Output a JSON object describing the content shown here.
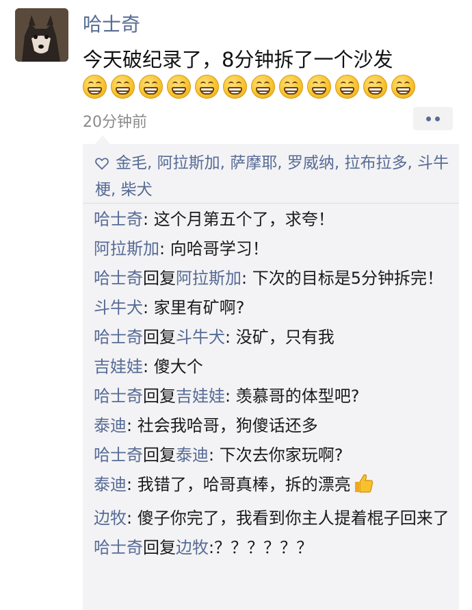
{
  "post": {
    "author": "哈士奇",
    "text": "今天破纪录了，8分钟拆了一个沙发",
    "emoji_count": 12,
    "emoji_icon": "grinning-face-icon",
    "timestamp": "20分钟前"
  },
  "likes": {
    "icon": "heart-icon",
    "names": "金毛, 阿拉斯加, 萨摩耶, 罗威纳, 拉布拉多, 斗牛梗, 柴犬"
  },
  "comments": [
    {
      "name": "哈士奇",
      "reply_word": "",
      "reply_to": "",
      "text": ": 这个月第五个了，求夸！"
    },
    {
      "name": "阿拉斯加",
      "reply_word": "",
      "reply_to": "",
      "text": ": 向哈哥学习！"
    },
    {
      "name": "哈士奇",
      "reply_word": "回复",
      "reply_to": "阿拉斯加",
      "text": ": 下次的目标是5分钟拆完！"
    },
    {
      "name": "斗牛犬",
      "reply_word": "",
      "reply_to": "",
      "text": ": 家里有矿啊?"
    },
    {
      "name": "哈士奇",
      "reply_word": "回复",
      "reply_to": "斗牛犬",
      "text": ": 没矿，只有我"
    },
    {
      "name": "吉娃娃",
      "reply_word": "",
      "reply_to": "",
      "text": ": 傻大个"
    },
    {
      "name": "哈士奇",
      "reply_word": "回复",
      "reply_to": "吉娃娃",
      "text": ": 羡慕哥的体型吧?"
    },
    {
      "name": "泰迪",
      "reply_word": "",
      "reply_to": "",
      "text": ": 社会我哈哥，狗傻话还多"
    },
    {
      "name": "哈士奇",
      "reply_word": "回复",
      "reply_to": "泰迪",
      "text": ": 下次去你家玩啊?"
    },
    {
      "name": "泰迪",
      "reply_word": "",
      "reply_to": "",
      "text": ": 我错了，哈哥真棒，拆的漂亮",
      "icon": "thumbs-up-icon"
    },
    {
      "name": "边牧",
      "reply_word": "",
      "reply_to": "",
      "text": ": 傻子你完了，我看到你主人提着棍子回来了"
    },
    {
      "name": "哈士奇",
      "reply_word": "回复",
      "reply_to": "边牧",
      "text": ":？？？？？？"
    }
  ],
  "colors": {
    "link": "#576b95",
    "comment_bg": "#f3f3f5",
    "timestamp": "#8a8a8a"
  }
}
